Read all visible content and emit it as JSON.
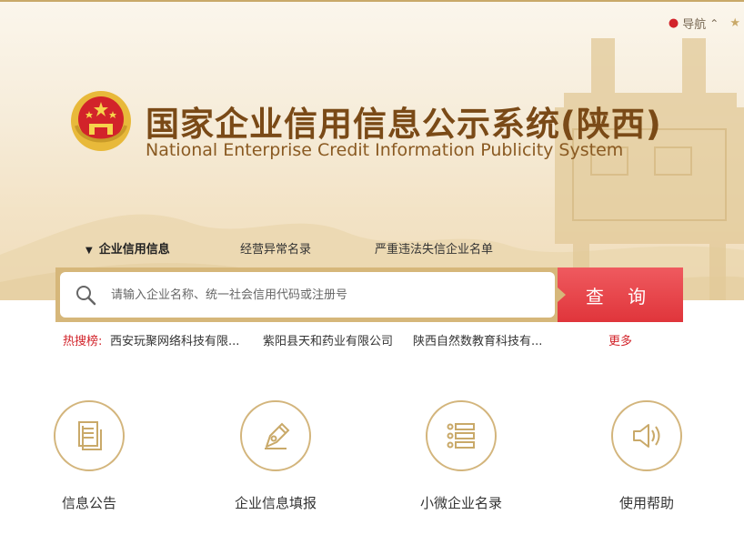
{
  "header": {
    "nav_label": "导航",
    "title_cn": "国家企业信用信息公示系统(陕西)",
    "title_en": "National Enterprise Credit Information Publicity System"
  },
  "tabs": [
    {
      "label": "企业信用信息",
      "active": true
    },
    {
      "label": "经营异常名录",
      "active": false
    },
    {
      "label": "严重违法失信企业名单",
      "active": false
    }
  ],
  "search": {
    "placeholder": "请输入企业名称、统一社会信用代码或注册号",
    "button_label": "查 询"
  },
  "hot_search": {
    "label": "热搜榜:",
    "items": [
      "西安玩聚网络科技有限...",
      "紫阳县天和药业有限公司",
      "陕西自然数教育科技有..."
    ],
    "more_label": "更多"
  },
  "services": [
    {
      "label": "信息公告",
      "icon": "document-icon"
    },
    {
      "label": "企业信息填报",
      "icon": "pen-nib-icon"
    },
    {
      "label": "小微企业名录",
      "icon": "list-icon"
    },
    {
      "label": "使用帮助",
      "icon": "speaker-icon"
    }
  ],
  "colors": {
    "brand_brown": "#7a4a17",
    "gold": "#d6b77a",
    "accent_red": "#e0353b"
  }
}
